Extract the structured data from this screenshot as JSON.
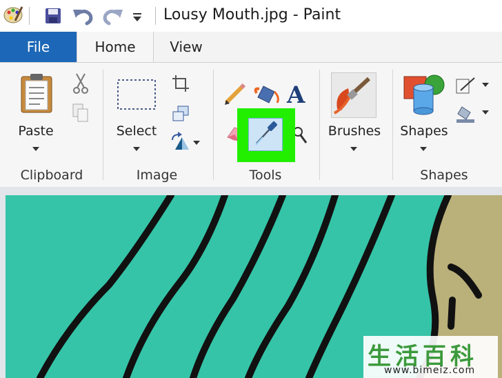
{
  "window": {
    "title": "Lousy Mouth.jpg - Paint"
  },
  "quick_access": {
    "icons": [
      "paint-palette-icon",
      "save-icon",
      "undo-icon",
      "redo-icon",
      "customize-dropdown-icon"
    ]
  },
  "tabs": [
    {
      "label": "File",
      "active": false
    },
    {
      "label": "Home",
      "active": true
    },
    {
      "label": "View",
      "active": false
    }
  ],
  "ribbon": {
    "clipboard": {
      "label": "Clipboard",
      "paste": "Paste"
    },
    "image": {
      "label": "Image",
      "select": "Select"
    },
    "tools": {
      "label": "Tools",
      "highlighted_tool": "color-picker",
      "highlight_color": "#22ee00"
    },
    "brushes": {
      "label": "Brushes"
    },
    "shapes": {
      "label": "Shapes",
      "button": "Shapes"
    }
  },
  "canvas": {
    "fill_color": "#35c4a8",
    "sand_color": "#b9b07a",
    "stroke_color": "#111111"
  },
  "watermark": {
    "chars": "生活百科",
    "url": "www.bimeiz.com"
  }
}
